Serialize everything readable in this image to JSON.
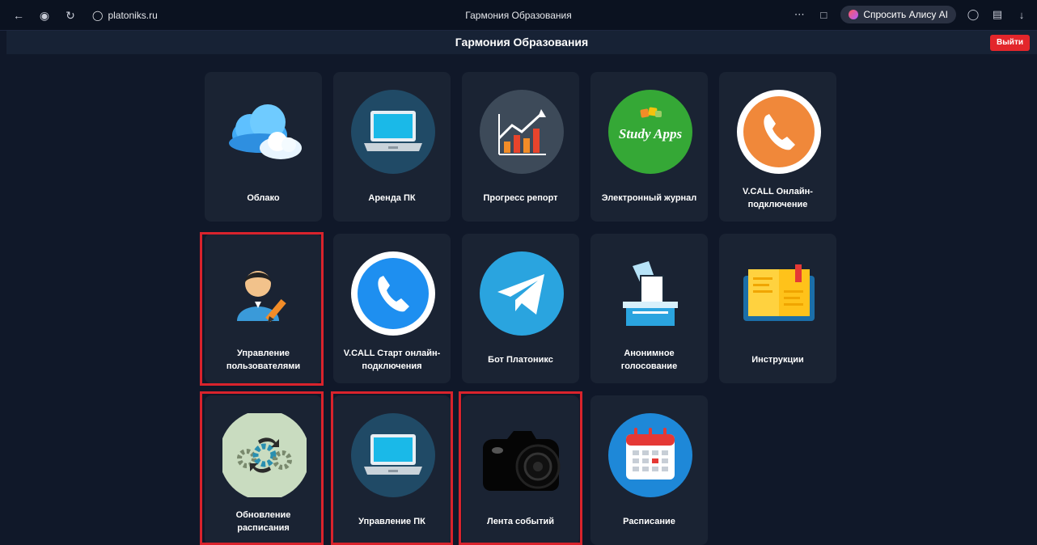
{
  "browser": {
    "url": "platoniks.ru",
    "tab_title": "Гармония Образования",
    "alisa_label": "Спросить Алису AI"
  },
  "app": {
    "title": "Гармония Образования",
    "logout_label": "Выйти"
  },
  "tiles": [
    {
      "label": "Облако",
      "icon": "cloud-icon"
    },
    {
      "label": "Аренда ПК",
      "icon": "laptop-icon"
    },
    {
      "label": "Прогресс репорт",
      "icon": "chart-icon"
    },
    {
      "label": "Электронный журнал",
      "icon": "study-apps-icon"
    },
    {
      "label": "V.CALL Онлайн-подключение",
      "icon": "phone-orange-icon"
    },
    {
      "label": "Управление пользователями",
      "icon": "user-edit-icon"
    },
    {
      "label": "V.CALL Старт онлайн-подключения",
      "icon": "phone-blue-icon"
    },
    {
      "label": "Бот Платоникс",
      "icon": "telegram-icon"
    },
    {
      "label": "Анонимное голосование",
      "icon": "ballot-box-icon"
    },
    {
      "label": "Инструкции",
      "icon": "book-icon"
    },
    {
      "label": "Обновление расписания",
      "icon": "gears-icon"
    },
    {
      "label": "Управление ПК",
      "icon": "laptop-icon"
    },
    {
      "label": "Лента событий",
      "icon": "camera-icon"
    },
    {
      "label": "Расписание",
      "icon": "calendar-icon"
    }
  ],
  "study_apps_text": "Study Apps",
  "colors": {
    "page_bg": "#101829",
    "card_bg": "#1a2333",
    "highlight": "#d9232c",
    "logout_bg": "#e3262b"
  }
}
